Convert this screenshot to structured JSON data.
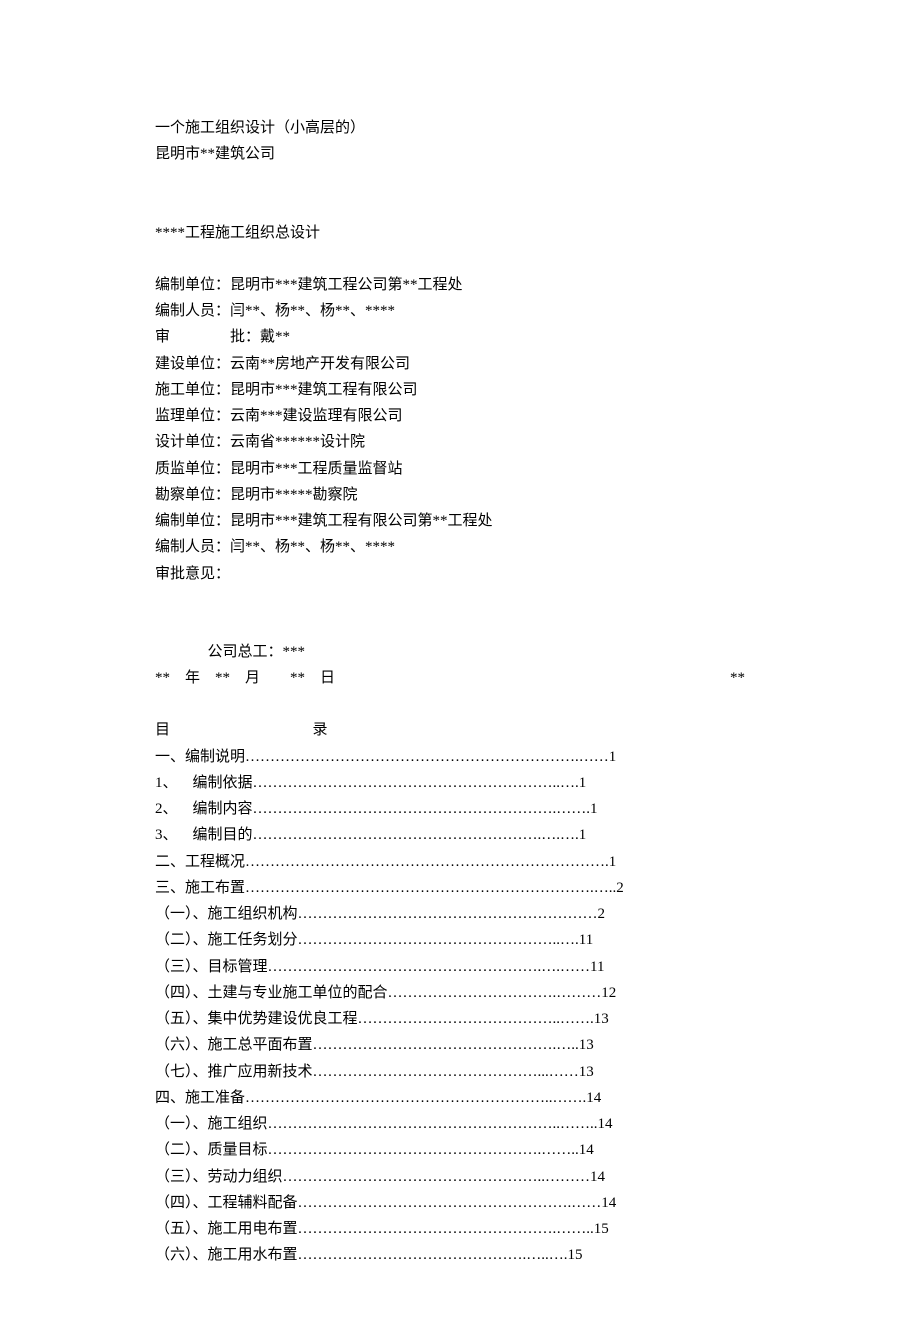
{
  "header": {
    "line1": "一个施工组织设计（小高层的）",
    "line2": "昆明市**建筑公司"
  },
  "title": "****工程施工组织总设计",
  "meta": {
    "org": "编制单位：昆明市***建筑工程公司第**工程处",
    "staff": "编制人员：闫**、杨**、杨**、****",
    "approve": "审　　　　批：戴**",
    "builder": "建设单位：云南**房地产开发有限公司",
    "constructor": "施工单位：昆明市***建筑工程有限公司",
    "supervisor": "监理单位：云南***建设监理有限公司",
    "designer": "设计单位：云南省******设计院",
    "quality": "质监单位：昆明市***工程质量监督站",
    "survey": "勘察单位：昆明市*****勘察院",
    "org2": "编制单位：昆明市***建筑工程有限公司第**工程处",
    "staff2": "编制人员：闫**、杨**、杨**、****",
    "opinion": "审批意见："
  },
  "sign": {
    "engineer": "公司总工：***",
    "right_star": "**",
    "date": "**　年　**　月　　**　日"
  },
  "toc": {
    "title_left": "目",
    "title_right": "录",
    "items": [
      "一、编制说明………………………………………………………….……1",
      "1、  编制依据……………………………………………………..….1",
      "2、  编制内容…………………………………………………….…….1",
      "3、  编制目的………………………………………………….….….1",
      "二、工程概况……………………………………………………………….1",
      "三、施工布置…………………………………………………………….…..2",
      "（一）、施工组织机构……………………………………………………2",
      "（二）、施工任务划分……………………………………………..….11",
      "（三）、目标管理……………………………………………….….……11",
      "（四）、土建与专业施工单位的配合…………………………….………12",
      "（五）、集中优势建设优良工程…………………………………..…….13",
      "（六）、施工总平面布置………………………………………….…..13",
      "（七）、推广应用新技术………………………………………...……13",
      "四、施工准备……………………………………………………..…….14",
      "（一）、施工组织…………………………………………………..……..14",
      "（二）、质量目标……………………………………………….……..14",
      "（三）、劳动力组织……………………………………………..………14",
      "（四）、工程辅料配备……………………………………………….……14",
      "（五）、施工用电布置…………………………………………….……..15",
      "（六）、施工用水布置……………………………………….…..….15"
    ]
  }
}
